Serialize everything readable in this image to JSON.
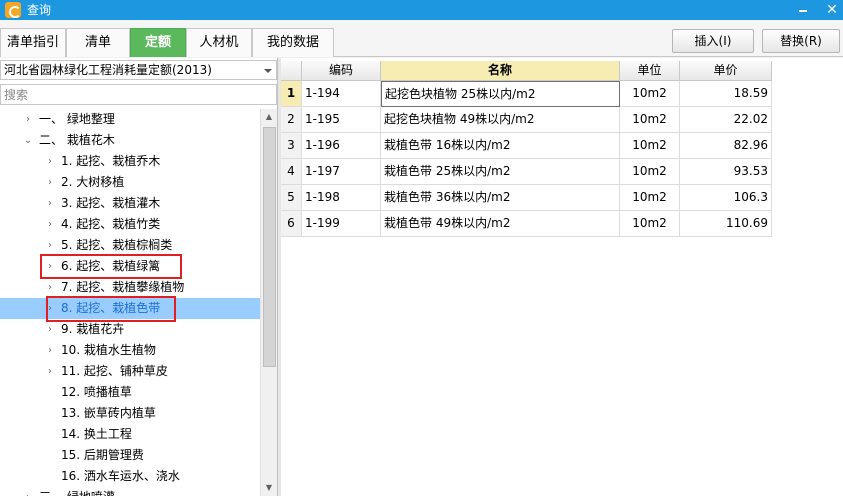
{
  "window": {
    "title": "查询",
    "minimize_label": "",
    "close_label": "✕"
  },
  "tabs": [
    {
      "label": "清单指引",
      "active": false
    },
    {
      "label": "清单",
      "active": false
    },
    {
      "label": "定额",
      "active": true
    },
    {
      "label": "人材机",
      "active": false
    },
    {
      "label": "我的数据",
      "active": false
    }
  ],
  "toolbar": {
    "insert_label": "插入(I)",
    "replace_label": "替换(R)"
  },
  "left": {
    "quota_library": "河北省园林绿化工程消耗量定额(2013)",
    "search_placeholder": "搜索",
    "tree": [
      {
        "label": "一、 绿地整理",
        "chevron": "›",
        "level": 0
      },
      {
        "label": "二、 栽植花木",
        "chevron": "⌄",
        "level": 0
      },
      {
        "label": "1.  起挖、栽植乔木",
        "chevron": "›",
        "level": 1
      },
      {
        "label": "2.  大树移植",
        "chevron": "›",
        "level": 1
      },
      {
        "label": "3.  起挖、栽植灌木",
        "chevron": "›",
        "level": 1
      },
      {
        "label": "4.  起挖、栽植竹类",
        "chevron": "›",
        "level": 1
      },
      {
        "label": "5.  起挖、栽植棕榈类",
        "chevron": "›",
        "level": 1
      },
      {
        "label": "6.  起挖、栽植绿篱",
        "chevron": "›",
        "level": 1
      },
      {
        "label": "7.  起挖、栽植攀缘植物",
        "chevron": "›",
        "level": 1
      },
      {
        "label": "8.  起挖、栽植色带",
        "chevron": "›",
        "level": 1,
        "selected": true
      },
      {
        "label": "9.  栽植花卉",
        "chevron": "›",
        "level": 1
      },
      {
        "label": "10.  栽植水生植物",
        "chevron": "›",
        "level": 1
      },
      {
        "label": "11.  起挖、铺种草皮",
        "chevron": "›",
        "level": 1
      },
      {
        "label": "12.  喷播植草",
        "chevron": "",
        "level": 1
      },
      {
        "label": "13.  嵌草砖内植草",
        "chevron": "",
        "level": 1
      },
      {
        "label": "14.  换土工程",
        "chevron": "",
        "level": 1
      },
      {
        "label": "15.  后期管理费",
        "chevron": "",
        "level": 1
      },
      {
        "label": "16.  洒水车运水、浇水",
        "chevron": "",
        "level": 1
      },
      {
        "label": "三、 绿地喷灌",
        "chevron": "›",
        "level": 0
      }
    ]
  },
  "grid": {
    "headers": {
      "index": "",
      "code": "编码",
      "name": "名称",
      "unit": "单位",
      "price": "单价"
    },
    "rows": [
      {
        "index": "1",
        "code": "1-194",
        "name": "起挖色块植物 25株以内/m2",
        "unit": "10m2",
        "price": "18.59"
      },
      {
        "index": "2",
        "code": "1-195",
        "name": "起挖色块植物 49株以内/m2",
        "unit": "10m2",
        "price": "22.02"
      },
      {
        "index": "3",
        "code": "1-196",
        "name": "栽植色带 16株以内/m2",
        "unit": "10m2",
        "price": "82.96"
      },
      {
        "index": "4",
        "code": "1-197",
        "name": "栽植色带 25株以内/m2",
        "unit": "10m2",
        "price": "93.53"
      },
      {
        "index": "5",
        "code": "1-198",
        "name": "栽植色带 36株以内/m2",
        "unit": "10m2",
        "price": "106.3"
      },
      {
        "index": "6",
        "code": "1-199",
        "name": "栽植色带 49株以内/m2",
        "unit": "10m2",
        "price": "110.69"
      }
    ]
  },
  "colors": {
    "titlebar": "#1e97e1",
    "active_tab": "#5cb85c",
    "selected_row": "#99ccff",
    "annotation_box": "#e02020",
    "grid_header_highlight": "#f7ecb2"
  }
}
